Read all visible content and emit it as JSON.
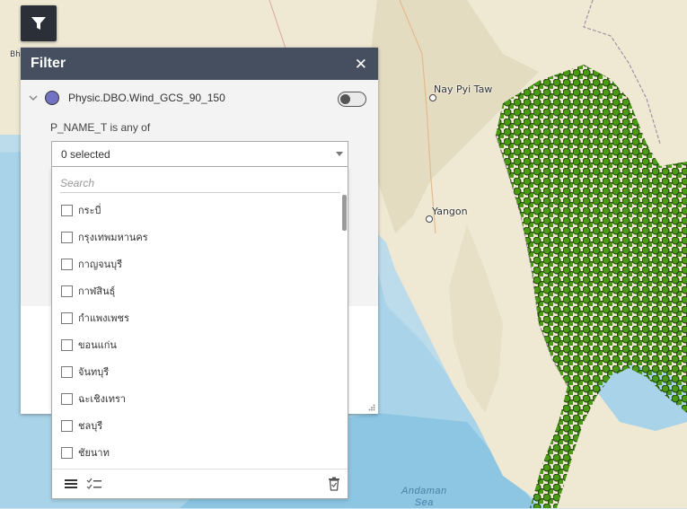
{
  "map": {
    "cities": [
      {
        "name": "Nay Pyi Taw"
      },
      {
        "name": "Yangon"
      }
    ],
    "sea_label_line1": "Andaman",
    "sea_label_line2": "Sea",
    "edge_label": "Bh",
    "colors": {
      "land": "#efe9d4",
      "water": "#bcdceb",
      "points": "#4a9a14",
      "point_outline": "#1c3b06"
    }
  },
  "filter_button": {
    "icon": "filter-icon"
  },
  "panel": {
    "title": "Filter",
    "close_icon": "close-icon",
    "layer": {
      "name": "Physic.DBO.Wind_GCS_90_150",
      "symbol_color": "#7272c2",
      "enabled": false
    },
    "condition_label": "P_NAME_T is any of",
    "select": {
      "value": "0 selected"
    },
    "dropdown": {
      "search_placeholder": "Search",
      "options": [
        {
          "label": "กระบี่"
        },
        {
          "label": "กรุงเทพมหานคร"
        },
        {
          "label": "กาญจนบุรี"
        },
        {
          "label": "กาฬสินธุ์"
        },
        {
          "label": "กำแพงเพชร"
        },
        {
          "label": "ขอนแก่น"
        },
        {
          "label": "จันทบุรี"
        },
        {
          "label": "ฉะเชิงเทรา"
        },
        {
          "label": "ชลบุรี"
        },
        {
          "label": "ชัยนาท"
        }
      ],
      "footer": {
        "list_icon": "list-icon",
        "selected_list_icon": "checklist-icon",
        "clear_icon": "trash-icon"
      }
    }
  }
}
